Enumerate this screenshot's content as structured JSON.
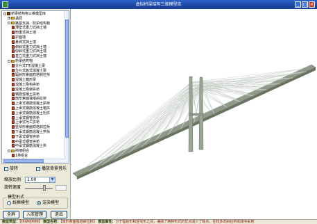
{
  "window": {
    "title": "虚拟桥梁结构三维模型库",
    "min": "_",
    "max": "□",
    "close": "×"
  },
  "tree": {
    "nodes": [
      {
        "level": 0,
        "toggle": "-",
        "icon": "book",
        "label": "桥梁结构物三维模型库"
      },
      {
        "level": 1,
        "toggle": "+",
        "icon": "folder",
        "label": "涵洞"
      },
      {
        "level": 1,
        "toggle": "-",
        "icon": "folder",
        "label": "路基支挡、防护结构物"
      },
      {
        "level": 2,
        "toggle": "",
        "icon": "page",
        "label": "薄壁式重力式挡土墙"
      },
      {
        "level": 2,
        "toggle": "",
        "icon": "page",
        "label": "衡重式挡土墙"
      },
      {
        "level": 2,
        "toggle": "",
        "icon": "page",
        "label": "护面墙"
      },
      {
        "level": 2,
        "toggle": "",
        "icon": "page",
        "label": "悬臂式挡土墙"
      },
      {
        "level": 2,
        "toggle": "",
        "icon": "page",
        "label": "俯斜式重力式挡土墙"
      },
      {
        "level": 2,
        "toggle": "",
        "icon": "page",
        "label": "仰斜式重力式挡土墙"
      },
      {
        "level": 2,
        "toggle": "",
        "icon": "page",
        "label": "直立式重力式挡土墙"
      },
      {
        "level": 1,
        "toggle": "-",
        "icon": "folder",
        "label": "桥梁结构物"
      },
      {
        "level": 2,
        "toggle": "",
        "icon": "page",
        "label": "分片式T形混凝土梁"
      },
      {
        "level": 2,
        "toggle": "",
        "icon": "page",
        "label": "分片式板式混凝土梁"
      },
      {
        "level": 2,
        "toggle": "",
        "icon": "page",
        "label": "辐射形索面双塔斜拉桥"
      },
      {
        "level": 2,
        "toggle": "",
        "icon": "page",
        "label": "混凝土箱形梁"
      },
      {
        "level": 2,
        "toggle": "",
        "icon": "page",
        "label": "混凝土刚构拱桥"
      },
      {
        "level": 2,
        "toggle": "",
        "icon": "page",
        "label": "混凝土刚架拱桥"
      },
      {
        "level": 2,
        "toggle": "",
        "icon": "page",
        "label": "钢筋混凝土拱桥"
      },
      {
        "level": 2,
        "toggle": "",
        "icon": "page",
        "label": "扇形索面独塔斜拉桥"
      },
      {
        "level": 2,
        "toggle": "",
        "icon": "page",
        "label": "上承式钢筋混凝土拱桥"
      },
      {
        "level": 2,
        "toggle": "",
        "icon": "page",
        "label": "上承式钢筋混凝土箱拱"
      },
      {
        "level": 2,
        "toggle": "",
        "icon": "page",
        "label": "上承式钢筋混凝土桁拱"
      },
      {
        "level": 2,
        "toggle": "",
        "icon": "page",
        "label": "上承式钢管拱桥"
      },
      {
        "level": 2,
        "toggle": "",
        "icon": "page",
        "label": "上承式圬工拱桥"
      },
      {
        "level": 2,
        "toggle": "",
        "icon": "page",
        "label": "竖琴形索面双塔斜拉桥"
      },
      {
        "level": 2,
        "toggle": "",
        "icon": "page",
        "label": "下承式钢筋混凝土拱桥"
      },
      {
        "level": 2,
        "toggle": "",
        "icon": "page",
        "label": "下承式钢管拱桥"
      },
      {
        "level": 2,
        "toggle": "",
        "icon": "page",
        "label": "中承式钢管拱桥"
      },
      {
        "level": 2,
        "toggle": "",
        "icon": "page",
        "label": "中承式钢筋混凝土拱"
      },
      {
        "level": 1,
        "toggle": "-",
        "icon": "folder",
        "label": "挡墙组合"
      },
      {
        "level": 2,
        "toggle": "",
        "icon": "page",
        "label": "1类组合"
      },
      {
        "level": 2,
        "toggle": "",
        "icon": "page",
        "label": "2类组合"
      }
    ]
  },
  "controls": {
    "rotate_label": "旋转",
    "music_label": "播放背景音乐",
    "scale_label": "缩放比例",
    "scale_value": "1.00",
    "speed_label": "旋转速度",
    "mode_group_title": "模型形式",
    "mode_options": [
      "线框模型",
      "渲染模型"
    ],
    "mode_selected": 1,
    "btn_fullscreen": "全屏",
    "btn_home": "入库管理",
    "btn_exit": "退出"
  },
  "status": {
    "label_type": "模型类型：",
    "value_type": "【桥梁结构物】",
    "label_name": "模型名称：",
    "value_name": "【扇形索面独塔斜拉桥】",
    "label_desc": "模型属性：",
    "value_desc": "分于辐射形和竖琴形之间，兼顾了两种形式的优点减少了缺点，在较多的斜拉桥实践中采用"
  },
  "colors": {
    "titlebar": "#1c49a8",
    "panel": "#ece9d8",
    "tower": "#9aa497",
    "deck": "#8f9a8b",
    "cable": "#c9cfc9"
  }
}
